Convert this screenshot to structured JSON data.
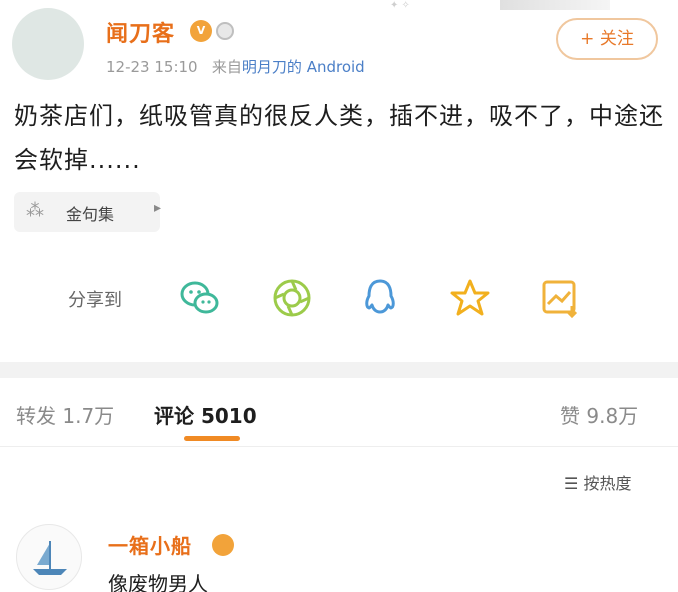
{
  "post": {
    "username": "闻刀客",
    "timestamp": "12-23 15:10",
    "source_prefix": "来自",
    "device": "明月刀的 Android",
    "follow_label": "+ 关注",
    "content": "奶茶店们，纸吸管真的很反人类，插不进，吸不了，中途还会软掉......",
    "topic_label": "金句集"
  },
  "share": {
    "label": "分享到",
    "icons": [
      "wechat-icon",
      "moments-icon",
      "qq-icon",
      "qzone-star-icon",
      "save-image-icon"
    ],
    "colors": {
      "wechat": "#3fb89a",
      "moments": "#9ccb4a",
      "qq": "#4c98d8",
      "star": "#f2b01e",
      "save": "#f0b23a"
    }
  },
  "tabs": {
    "repost": "转发 1.7万",
    "comments": "评论 5010",
    "likes": "赞 9.8万"
  },
  "sort": {
    "label": "按热度"
  },
  "comment": {
    "username": "一箱小船",
    "text": "像废物男人"
  },
  "colors": {
    "accent": "#e86f1a",
    "tab_underline": "#f08a24"
  }
}
